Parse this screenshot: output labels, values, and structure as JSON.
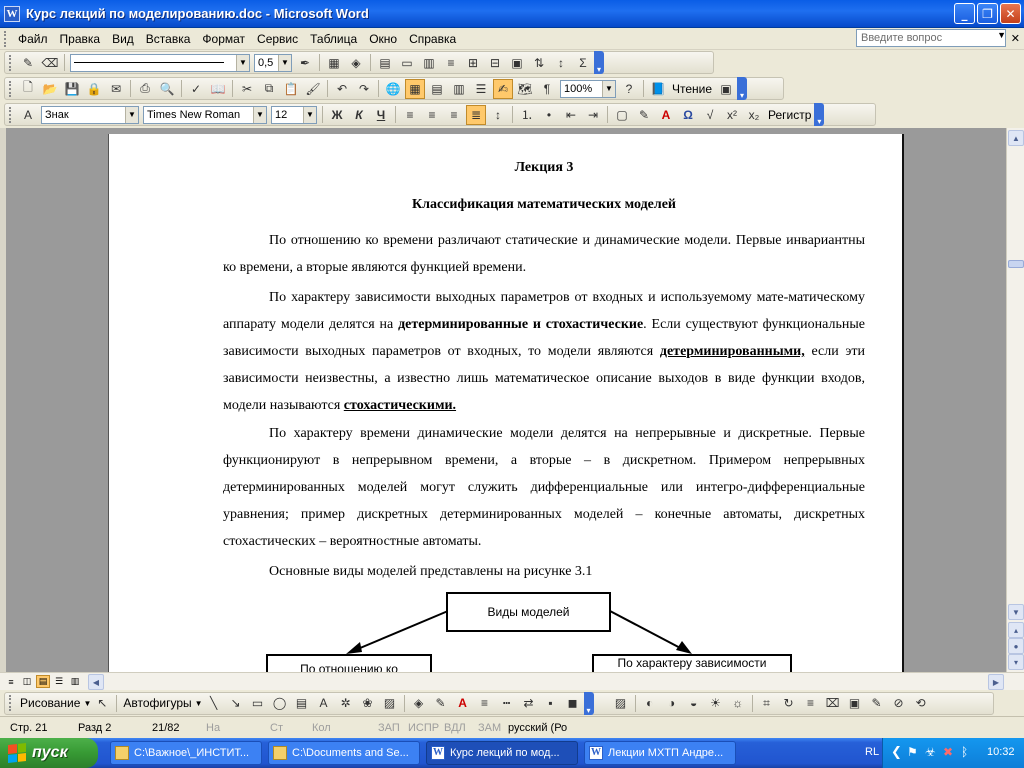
{
  "window": {
    "title": "Курс лекций по моделированию.doc - Microsoft Word"
  },
  "menu": {
    "items": [
      "Файл",
      "Правка",
      "Вид",
      "Вставка",
      "Формат",
      "Сервис",
      "Таблица",
      "Окно",
      "Справка"
    ],
    "help_placeholder": "Введите вопрос"
  },
  "toolbar_tables": {
    "line_weight": "0,5"
  },
  "toolbar_standard": {
    "zoom": "100%",
    "reading": "Чтение"
  },
  "toolbar_format": {
    "style": "Знак",
    "font": "Times New Roman",
    "size": "12",
    "bold": "Ж",
    "italic": "К",
    "underline": "Ч",
    "register": "Регистр"
  },
  "document": {
    "title": "Лекция 3",
    "subtitle": "Классификация математических моделей",
    "p1": "По отношению ко времени различают статические и динамические модели. Первые инвариантны ко времени, а вторые являются функцией времени.",
    "p2_a": "По характеру зависимости выходных параметров от входных и используемому мате-матическому аппарату модели делятся на ",
    "p2_b": "детерминированные и стохастические",
    "p2_c": ". Если существуют функциональные зависимости выходных параметров от входных, то модели являются ",
    "p2_d": "детерминированными,",
    "p2_e": " если эти зависимости неизвестны, а известно лишь математическое  описание выходов в виде функции входов, модели называются ",
    "p2_f": "стохастическими.",
    "p3": "По характеру времени динамические модели делятся на непрерывные и дискретные. Первые функционируют в непрерывном времени, а вторые – в дискретном.  Примером непрерывных детерминированных моделей могут служить дифференциальные или интегро-дифференциальные уравнения; пример дискретных детерминированных моделей – конечные автоматы, дискретных стохастических – вероятностные автоматы.",
    "p4": "Основные виды моделей представлены на рисунке 3.1",
    "diagram": {
      "root": "Виды моделей",
      "left": "По отношению ко",
      "right": "По характеру зависимости"
    }
  },
  "drawing_toolbar": {
    "draw": "Рисование",
    "autoshapes": "Автофигуры"
  },
  "status": {
    "page": "Стр.  21",
    "section": "Разд  2",
    "count": "21/82",
    "at": "На",
    "line": "Ст",
    "col": "Кол",
    "rec": "ЗАП",
    "trk": "ИСПР",
    "ext": "ВДЛ",
    "ovr": "ЗАМ",
    "lang": "русский (Ро"
  },
  "taskbar": {
    "start": "пуск",
    "tasks": [
      "C:\\Важное\\_ИНСТИТ...",
      "C:\\Documents and Se...",
      "Курс лекций по мод...",
      "Лекции МХТП Андре..."
    ],
    "lang": "RL",
    "clock": "10:32"
  }
}
